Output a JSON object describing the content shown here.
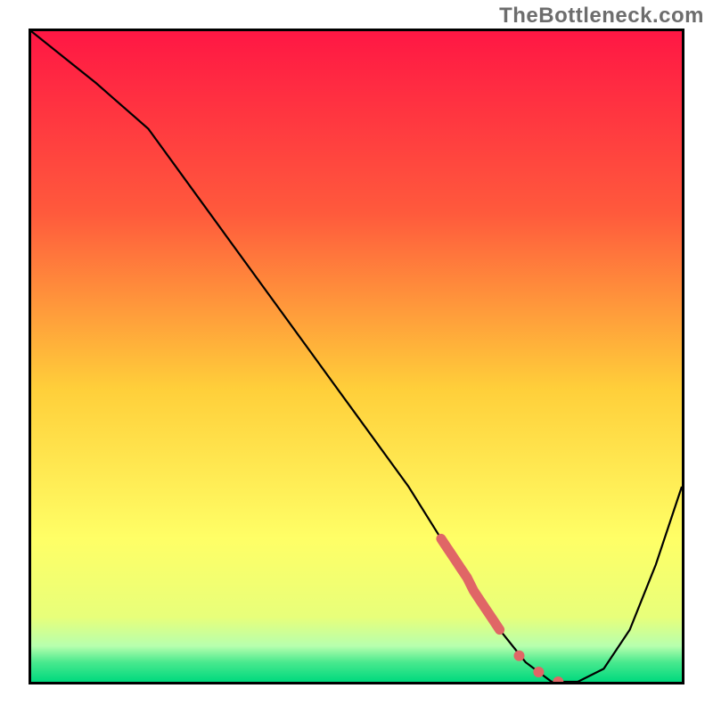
{
  "watermark": "TheBottleneck.com",
  "colors": {
    "frame": "#000000",
    "curve": "#000000",
    "dots": "#e06666",
    "gradient_top": "#ff1744",
    "gradient_upper": "#ff6a3d",
    "gradient_mid": "#ffd33a",
    "gradient_lower": "#f7ff66",
    "gradient_band": "#8dffb0",
    "gradient_bottom": "#00d97e"
  },
  "chart_data": {
    "type": "line",
    "title": "",
    "xlabel": "",
    "ylabel": "",
    "xlim": [
      0,
      100
    ],
    "ylim": [
      0,
      100
    ],
    "series": [
      {
        "name": "bottleneck-curve",
        "x": [
          0,
          10,
          18,
          26,
          34,
          42,
          50,
          58,
          63,
          68,
          72,
          76,
          80,
          84,
          88,
          92,
          96,
          100
        ],
        "y": [
          100,
          92,
          85,
          74,
          63,
          52,
          41,
          30,
          22,
          14,
          8,
          3,
          0,
          0,
          2,
          8,
          18,
          30
        ]
      }
    ],
    "highlight_segment": {
      "name": "highlight-dots",
      "x": [
        63,
        64,
        65,
        66,
        67,
        68,
        69,
        70,
        71,
        72,
        75,
        78,
        81
      ],
      "y": [
        22,
        20.5,
        19,
        17.5,
        16,
        14,
        12.5,
        11,
        9.5,
        8,
        4,
        1.5,
        0
      ]
    },
    "gradient_stops": [
      {
        "offset": 0.0,
        "color": "#ff1744"
      },
      {
        "offset": 0.28,
        "color": "#ff5a3c"
      },
      {
        "offset": 0.55,
        "color": "#ffcf3a"
      },
      {
        "offset": 0.78,
        "color": "#ffff66"
      },
      {
        "offset": 0.9,
        "color": "#e8ff7a"
      },
      {
        "offset": 0.945,
        "color": "#b7ffae"
      },
      {
        "offset": 0.97,
        "color": "#49e98e"
      },
      {
        "offset": 1.0,
        "color": "#00d97e"
      }
    ]
  }
}
